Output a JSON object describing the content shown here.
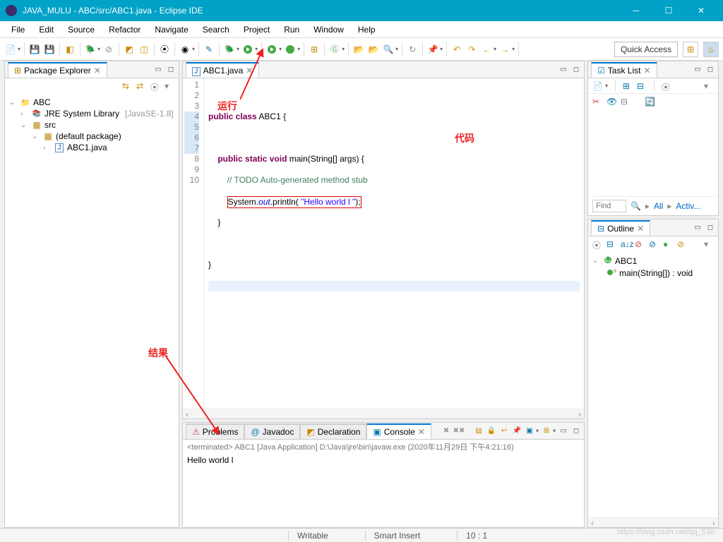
{
  "titlebar": {
    "title": "JAVA_MULU - ABC/src/ABC1.java - Eclipse IDE"
  },
  "menubar": [
    "File",
    "Edit",
    "Source",
    "Refactor",
    "Navigate",
    "Search",
    "Project",
    "Run",
    "Window",
    "Help"
  ],
  "quickaccess": "Quick Access",
  "packageExplorer": {
    "title": "Package Explorer",
    "project": "ABC",
    "jre": "JRE System Library",
    "jreVersion": "[JavaSE-1.8]",
    "src": "src",
    "pkg": "(default package)",
    "file": "ABC1.java"
  },
  "editor": {
    "tab": "ABC1.java",
    "lines": [
      "1",
      "2",
      "3",
      "4",
      "5",
      "6",
      "7",
      "8",
      "9",
      "10"
    ],
    "code": {
      "l2_kw1": "public",
      "l2_kw2": "class",
      "l2_id": " ABC1 {",
      "l4_kw1": "public",
      "l4_kw2": "static",
      "l4_kw3": "void",
      "l4_rest": " main(String[] args) {",
      "l5": "        // TODO Auto-generated method stub",
      "l6_a": "System.",
      "l6_b": "out",
      "l6_c": ".println( ",
      "l6_d": "\"Hello world l \"",
      "l6_e": ");",
      "l7": "    }",
      "l9": "}"
    }
  },
  "bottomTabs": {
    "problems": "Problems",
    "javadoc": "Javadoc",
    "declaration": "Declaration",
    "console": "Console"
  },
  "console": {
    "header": "<terminated> ABC1 [Java Application] D:\\Java\\jre\\bin\\javaw.exe (2020年11月29日 下午4:21:16)",
    "output": "Hello world l"
  },
  "taskList": {
    "title": "Task List",
    "find": "Find",
    "all": "All",
    "activ": "Activ..."
  },
  "outline": {
    "title": "Outline",
    "class": "ABC1",
    "method": "main(String[]) : void"
  },
  "statusbar": {
    "writable": "Writable",
    "insert": "Smart Insert",
    "pos": "10 : 1"
  },
  "annotations": {
    "run": "运行",
    "code": "代码",
    "result": "结果"
  },
  "watermark": "https://blog.csdn.net/qq_530"
}
